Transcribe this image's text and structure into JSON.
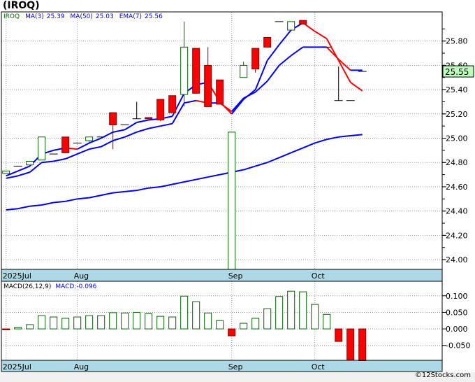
{
  "title": "(IROQ)",
  "legend": {
    "symbol": "IROQ",
    "ma3_label": "MA(3)",
    "ma3_value": "25.39",
    "ma50_label": "MA(50)",
    "ma50_value": "25.03",
    "ema7_label": "EMA(7)",
    "ema7_value": "25.56"
  },
  "macd_legend": {
    "label": "MACD(26,12,9)",
    "value": "MACD:-0.096"
  },
  "footer": "©12Stocks.com",
  "colors": {
    "up": "#006400",
    "down": "#ff0000",
    "ma_up": "#0000ff",
    "ma_down": "#ff0000",
    "date_bar": "#add8e6",
    "price_tag": "#bbffbb"
  },
  "chart_data": [
    {
      "type": "candlestick",
      "x_labels": [
        {
          "index": 0,
          "label": "2025Jul"
        },
        {
          "index": 6,
          "label": "Aug"
        },
        {
          "index": 19,
          "label": "Sep"
        },
        {
          "index": 26,
          "label": "Oct"
        }
      ],
      "ylim": [
        23.92,
        26.04
      ],
      "y_ticks": [
        "25.80",
        "25.60",
        "25.40",
        "25.20",
        "25.00",
        "24.80",
        "24.60",
        "24.40",
        "24.20",
        "24.00"
      ],
      "last_price": "25.55",
      "grid": true,
      "ohlc": [
        [
          24.71,
          24.73,
          24.71,
          24.73
        ],
        [
          24.77,
          24.77,
          24.77,
          24.77
        ],
        [
          24.78,
          24.81,
          24.78,
          24.81
        ],
        [
          24.82,
          25.01,
          24.82,
          25.01
        ],
        [
          24.87,
          24.87,
          24.87,
          24.87
        ],
        [
          25.01,
          25.01,
          24.88,
          24.88
        ],
        [
          24.96,
          24.96,
          24.96,
          24.96
        ],
        [
          24.98,
          25.01,
          24.96,
          25.01
        ],
        [
          25.01,
          25.01,
          25.01,
          25.01
        ],
        [
          25.21,
          25.21,
          24.91,
          25.11
        ],
        [
          25.11,
          25.11,
          25.11,
          25.11
        ],
        [
          25.16,
          25.3,
          25.16,
          25.16
        ],
        [
          25.17,
          25.17,
          25.16,
          25.16
        ],
        [
          25.32,
          25.32,
          25.14,
          25.15
        ],
        [
          25.35,
          25.35,
          25.21,
          25.21
        ],
        [
          25.36,
          25.96,
          25.26,
          25.75
        ],
        [
          25.74,
          25.74,
          25.37,
          25.37
        ],
        [
          25.6,
          25.75,
          25.26,
          25.26
        ],
        [
          25.48,
          25.48,
          25.28,
          25.28
        ],
        [
          23.92,
          25.05,
          23.92,
          25.05
        ],
        [
          25.5,
          25.63,
          25.5,
          25.6
        ],
        [
          25.74,
          25.74,
          25.54,
          25.57
        ],
        [
          25.83,
          25.83,
          25.75,
          25.75
        ],
        [
          25.96,
          25.96,
          25.96,
          25.96
        ],
        [
          25.89,
          25.96,
          25.89,
          25.96
        ],
        [
          25.97,
          25.97,
          25.94,
          25.94
        ],
        null,
        [
          25.75,
          25.75,
          25.75,
          25.75
        ],
        [
          25.31,
          25.59,
          25.31,
          25.31
        ],
        [
          25.31,
          25.31,
          25.31,
          25.31
        ],
        [
          25.55,
          25.55,
          25.55,
          25.55
        ]
      ],
      "series": [
        {
          "name": "MA(3)",
          "values": [
            24.69,
            24.73,
            24.77,
            24.87,
            24.9,
            24.92,
            24.91,
            24.96,
            25.0,
            25.05,
            25.07,
            25.13,
            25.15,
            25.16,
            25.18,
            25.37,
            25.44,
            25.46,
            25.3,
            25.2,
            25.32,
            25.4,
            25.64,
            25.77,
            25.89,
            25.95,
            25.88,
            25.82,
            25.64,
            25.46,
            25.39
          ]
        },
        {
          "name": "EMA(7)",
          "values": [
            24.67,
            24.69,
            24.72,
            24.8,
            24.81,
            24.83,
            24.87,
            24.91,
            24.93,
            24.98,
            25.01,
            25.05,
            25.08,
            25.1,
            25.12,
            25.29,
            25.31,
            25.29,
            25.29,
            25.22,
            25.33,
            25.38,
            25.47,
            25.6,
            25.68,
            25.75,
            25.75,
            25.75,
            25.65,
            25.56,
            25.56
          ]
        },
        {
          "name": "MA(50)",
          "values": [
            24.41,
            24.42,
            24.44,
            24.45,
            24.47,
            24.48,
            24.5,
            24.51,
            24.53,
            24.55,
            24.56,
            24.57,
            24.59,
            24.6,
            24.62,
            24.64,
            24.66,
            24.68,
            24.7,
            24.72,
            24.74,
            24.77,
            24.8,
            24.84,
            24.88,
            24.92,
            24.96,
            24.99,
            25.01,
            25.02,
            25.03
          ]
        }
      ]
    },
    {
      "type": "bar",
      "name": "MACD(26,12,9)",
      "ylim": [
        -0.095,
        0.144
      ],
      "y_ticks": [
        "0.100",
        "0.050",
        "0.000",
        "-0.050"
      ],
      "values": [
        -0.003,
        0.004,
        0.013,
        0.04,
        0.036,
        0.032,
        0.036,
        0.04,
        0.04,
        0.049,
        0.048,
        0.05,
        0.046,
        0.038,
        0.036,
        0.099,
        0.082,
        0.048,
        0.025,
        -0.021,
        0.017,
        0.032,
        0.061,
        0.098,
        0.114,
        0.112,
        0.074,
        0.044,
        -0.038,
        -0.094,
        -0.096
      ]
    }
  ]
}
